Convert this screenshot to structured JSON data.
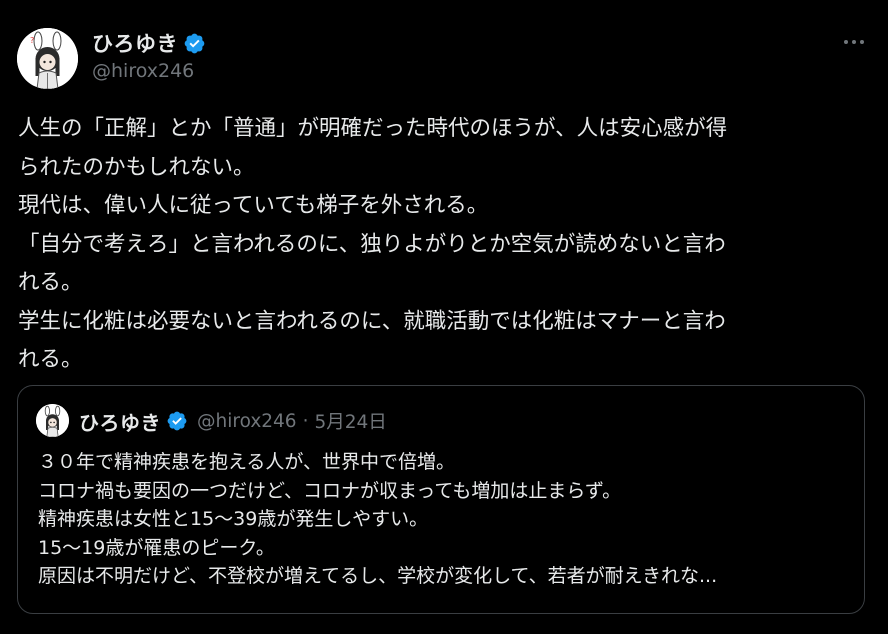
{
  "tweet": {
    "author": {
      "display_name": "ひろゆき",
      "handle": "@hirox246",
      "verified_icon": "verified-badge-icon",
      "avatar_icon": "avatar-illustration"
    },
    "menu_icon": "more-options-icon",
    "lines": [
      "人生の「正解」とか「普通」が明確だった時代のほうが、人は安心感が得",
      "られたのかもしれない。",
      "現代は、偉い人に従っていても梯子を外される。",
      "「自分で考えろ」と言われるのに、独りよがりとか空気が読めないと言わ",
      "れる。",
      "学生に化粧は必要ないと言われるのに、就職活動では化粧はマナーと言わ",
      "れる。"
    ]
  },
  "quoted_tweet": {
    "author": {
      "display_name": "ひろゆき",
      "handle": "@hirox246",
      "separator": "·",
      "date": "5月24日",
      "verified_icon": "verified-badge-icon"
    },
    "lines": [
      "３０年で精神疾患を抱える人が、世界中で倍増。",
      "コロナ禍も要因の一つだけど、コロナが収まっても増加は止まらず。",
      "精神疾患は女性と15〜39歳が発生しやすい。",
      "15〜19歳が罹患のピーク。",
      "原因は不明だけど、不登校が増えてるし、学校が変化して、若者が耐えきれな..."
    ]
  },
  "colors": {
    "background": "#000000",
    "text_primary": "#e7e9ea",
    "text_secondary": "#71767b",
    "verified_blue": "#1d9bf0",
    "border": "#3a3e42"
  }
}
